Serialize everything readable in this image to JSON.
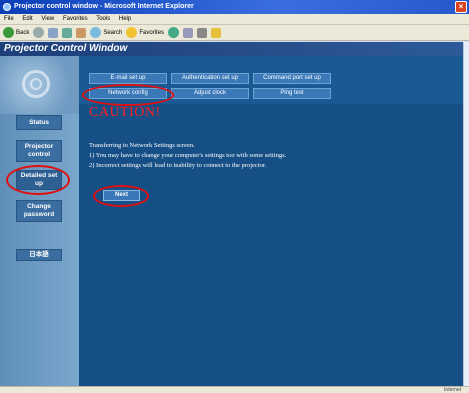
{
  "browser": {
    "title": "Projector control window - Microsoft Internet Explorer",
    "menu": [
      "File",
      "Edit",
      "View",
      "Favorites",
      "Tools",
      "Help"
    ],
    "toolbar": {
      "back": "Back",
      "search": "Search",
      "favorites": "Favorites"
    },
    "status": "Internet"
  },
  "app": {
    "title": "Projector Control Window"
  },
  "sidebar": {
    "status": "Status",
    "projector_control": "Projector control",
    "detailed_setup": "Detailed set up",
    "change_password": "Change password",
    "japanese": "日本語"
  },
  "tabs": {
    "email": "E-mail set up",
    "auth": "Authentication set up",
    "command": "Command port set up",
    "network": "Network config",
    "clock": "Adjust clock",
    "ping": "Ping test"
  },
  "content": {
    "caution": "CAUTION!",
    "line1": "Transferring to Network Settings screen.",
    "line2": "1)  You may have to change your computer's settings too with some settings.",
    "line3": "2)  Incorrect settings will lead to inability to connect to the projector.",
    "next": "Next"
  },
  "colors": {
    "highlight_ring": "#e01010",
    "caution": "#ff2020",
    "main_bg": "#164f86"
  }
}
